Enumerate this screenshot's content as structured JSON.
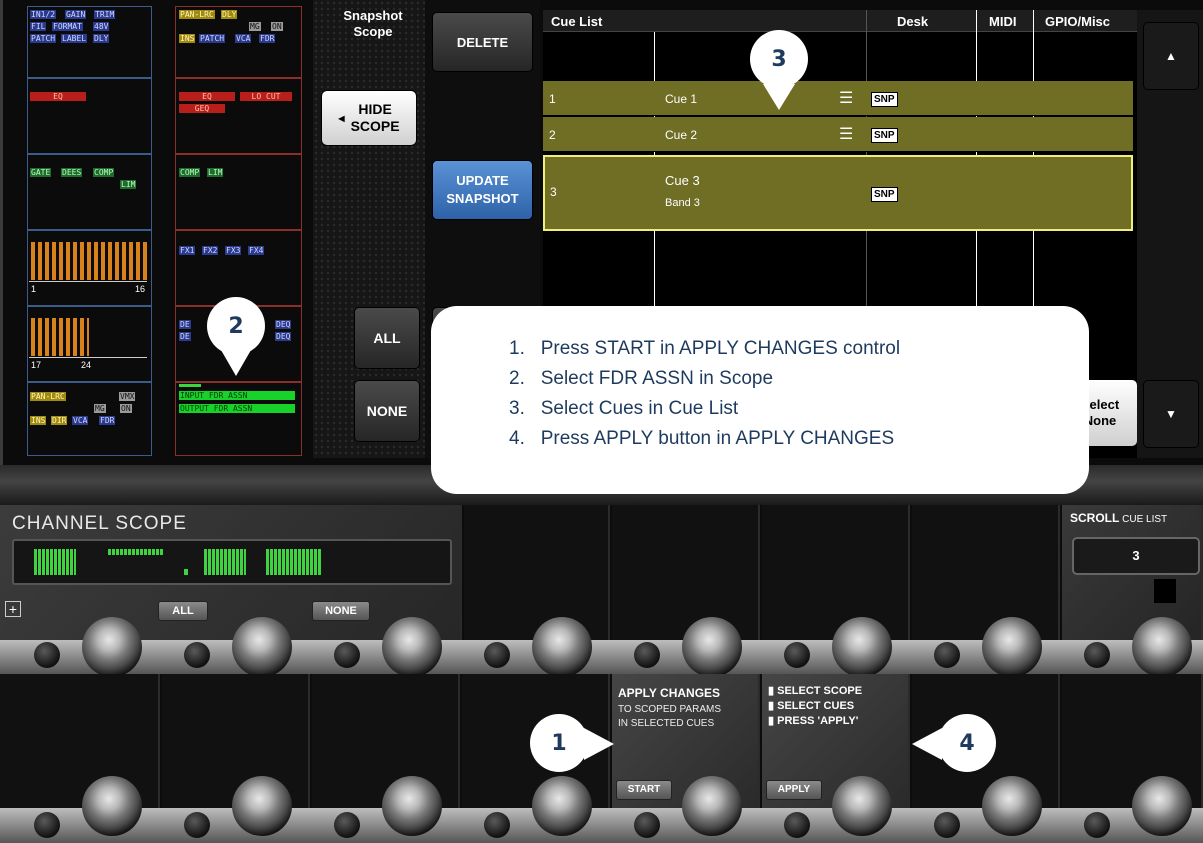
{
  "scope_panel": {
    "col1_tags_row1": [
      "IN1/2",
      "GAIN",
      "TRIM"
    ],
    "col1_tags_row2": [
      "FIL",
      "FORMAT",
      "48V"
    ],
    "col1_tags_row3": [
      "PATCH",
      "LABEL",
      "DLY"
    ],
    "col2_tags_row1": [
      "PAN-LRC",
      "DLY"
    ],
    "col2_tags_row2": [
      "MG",
      "ON"
    ],
    "col2_tags_row3": [
      "INS",
      "PATCH",
      "VCA",
      "FDR"
    ],
    "eq_label": "EQ",
    "eq_col2": [
      "EQ",
      "LO CUT"
    ],
    "geq_label": "GEQ",
    "dyn_col1": [
      "GATE",
      "DEES",
      "COMP"
    ],
    "lim_label": "LIM",
    "dyn_col2": [
      "COMP",
      "LIM"
    ],
    "fx_tags": [
      "FX1",
      "FX2",
      "FX3",
      "FX4"
    ],
    "bus_labels_a": [
      "1",
      "16"
    ],
    "bus_labels_b": [
      "17",
      "24"
    ],
    "deq_tags": [
      "DEQ",
      "DEQ"
    ],
    "bottom_col1_row1": [
      "PAN-LRC",
      "VMX"
    ],
    "bottom_col1_row2": [
      "MG",
      "ON"
    ],
    "bottom_col1_row3": [
      "INS",
      "DIR",
      "VCA",
      "FDR"
    ],
    "fdr_assn": [
      "INPUT FDR ASSN",
      "OUTPUT FDR ASSN"
    ]
  },
  "snapshot_scope": {
    "title_line1": "Snapshot",
    "title_line2": "Scope",
    "hide_scope_line1": "HIDE",
    "hide_scope_line2": "SCOPE",
    "all_label": "ALL",
    "none_label": "NONE"
  },
  "actions": {
    "delete_label": "DELETE",
    "update_line1": "UPDATE",
    "update_line2": "SNAPSHOT"
  },
  "cue_list": {
    "headers": [
      "Cue List",
      "Desk",
      "MIDI",
      "GPIO/Misc"
    ],
    "rows": [
      {
        "num": "1",
        "name": "Cue 1",
        "sub": "",
        "badge": "SNP"
      },
      {
        "num": "2",
        "name": "Cue 2",
        "sub": "",
        "badge": "SNP"
      },
      {
        "num": "3",
        "name": "Cue 3",
        "sub": "Band 3",
        "badge": "SNP"
      }
    ],
    "select_none_line1": "Select",
    "select_none_line2": "None",
    "scroll_up_icon": "▲",
    "scroll_down_icon": "▼"
  },
  "instructions": {
    "steps": [
      "Press START in APPLY CHANGES control",
      "Select FDR ASSN in Scope",
      "Select Cues in Cue List",
      "Press APPLY button in APPLY CHANGES"
    ],
    "numbers": [
      "1.",
      "2.",
      "3.",
      "4."
    ]
  },
  "callouts": {
    "c1": "1",
    "c2": "2",
    "c3": "3",
    "c4": "4"
  },
  "channel_scope": {
    "title": "CHANNEL SCOPE",
    "all_label": "ALL",
    "none_label": "NONE",
    "plus_icon": "+"
  },
  "scroll": {
    "title_bold": "SCROLL",
    "title_rest": " CUE LIST",
    "value": "3"
  },
  "apply_changes": {
    "title": "APPLY CHANGES",
    "line2": "TO SCOPED PARAMS",
    "line3": "IN SELECTED CUES",
    "start_label": "START",
    "steps": [
      "SELECT SCOPE",
      "SELECT CUES",
      "PRESS 'APPLY'"
    ],
    "apply_label": "APPLY"
  },
  "colors": {
    "cue_row": "#6f6e24",
    "cue_selected": "#efef80",
    "update": "#3a78c2",
    "meter": "#d9811a",
    "led_green": "#39d63c"
  }
}
